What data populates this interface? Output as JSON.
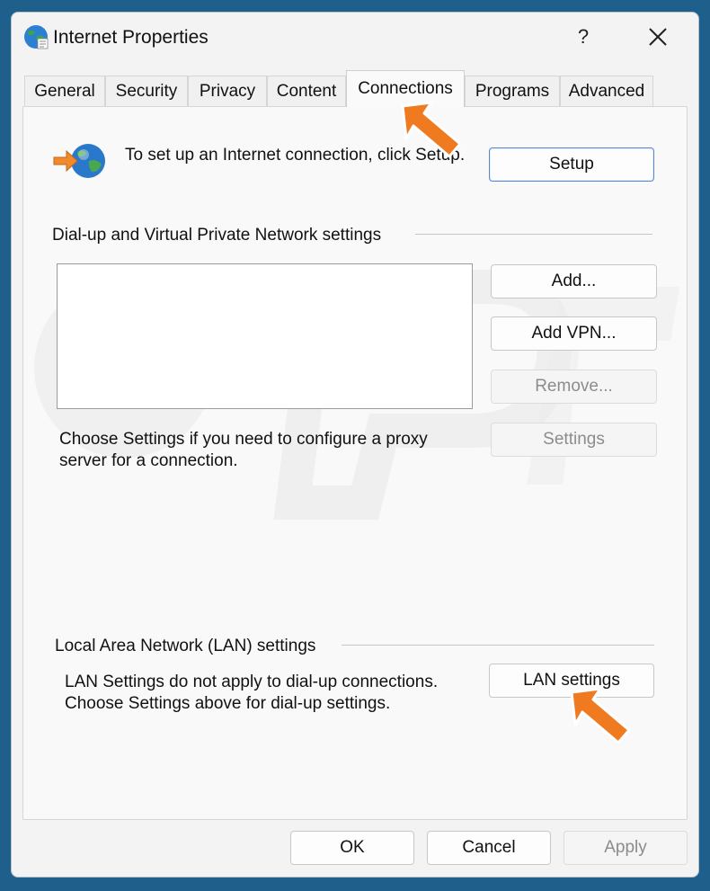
{
  "window": {
    "title": "Internet Properties",
    "help_label": "?",
    "close_label": "close"
  },
  "tabs": [
    {
      "label": "General",
      "active": false
    },
    {
      "label": "Security",
      "active": false
    },
    {
      "label": "Privacy",
      "active": false
    },
    {
      "label": "Content",
      "active": false
    },
    {
      "label": "Connections",
      "active": true
    },
    {
      "label": "Programs",
      "active": false
    },
    {
      "label": "Advanced",
      "active": false
    }
  ],
  "setup": {
    "text": "To set up an Internet connection, click Setup.",
    "button_label": "Setup"
  },
  "vpn": {
    "section_label": "Dial-up and Virtual Private Network settings",
    "items": [],
    "add_label": "Add...",
    "add_vpn_label": "Add VPN...",
    "remove_label": "Remove...",
    "settings_label": "Settings",
    "proxy_text": "Choose Settings if you need to configure a proxy server for a connection."
  },
  "lan": {
    "section_label": "Local Area Network (LAN) settings",
    "text": "LAN Settings do not apply to dial-up connections. Choose Settings above for dial-up settings.",
    "button_label": "LAN settings"
  },
  "footer": {
    "ok_label": "OK",
    "cancel_label": "Cancel",
    "apply_label": "Apply"
  },
  "colors": {
    "accent": "#0067c0",
    "arrow": "#f07a1f",
    "disabled_text": "#8c8c8c"
  },
  "icons": [
    "globe-icon",
    "connection-globe-icon",
    "close-icon",
    "arrow-pointer-icon"
  ]
}
